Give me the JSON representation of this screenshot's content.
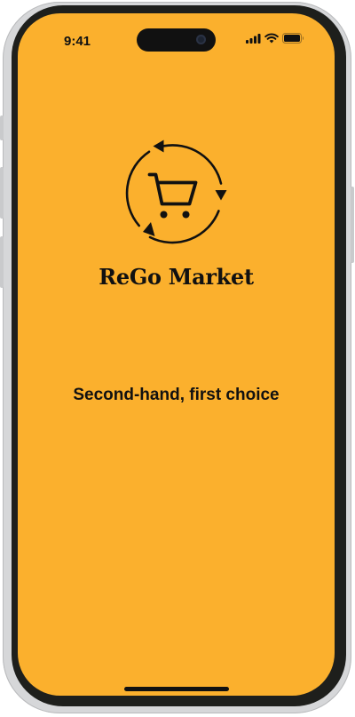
{
  "status_bar": {
    "time": "9:41",
    "icons": [
      "cellular-signal-icon",
      "wifi-icon",
      "battery-icon"
    ]
  },
  "app": {
    "name": "ReGo Market",
    "tagline": "Second-hand, first choice",
    "logo_icon": "recycle-cart-icon"
  },
  "colors": {
    "background": "#FBB02D",
    "text": "#111111",
    "device_frame": "#1E1F1C"
  }
}
